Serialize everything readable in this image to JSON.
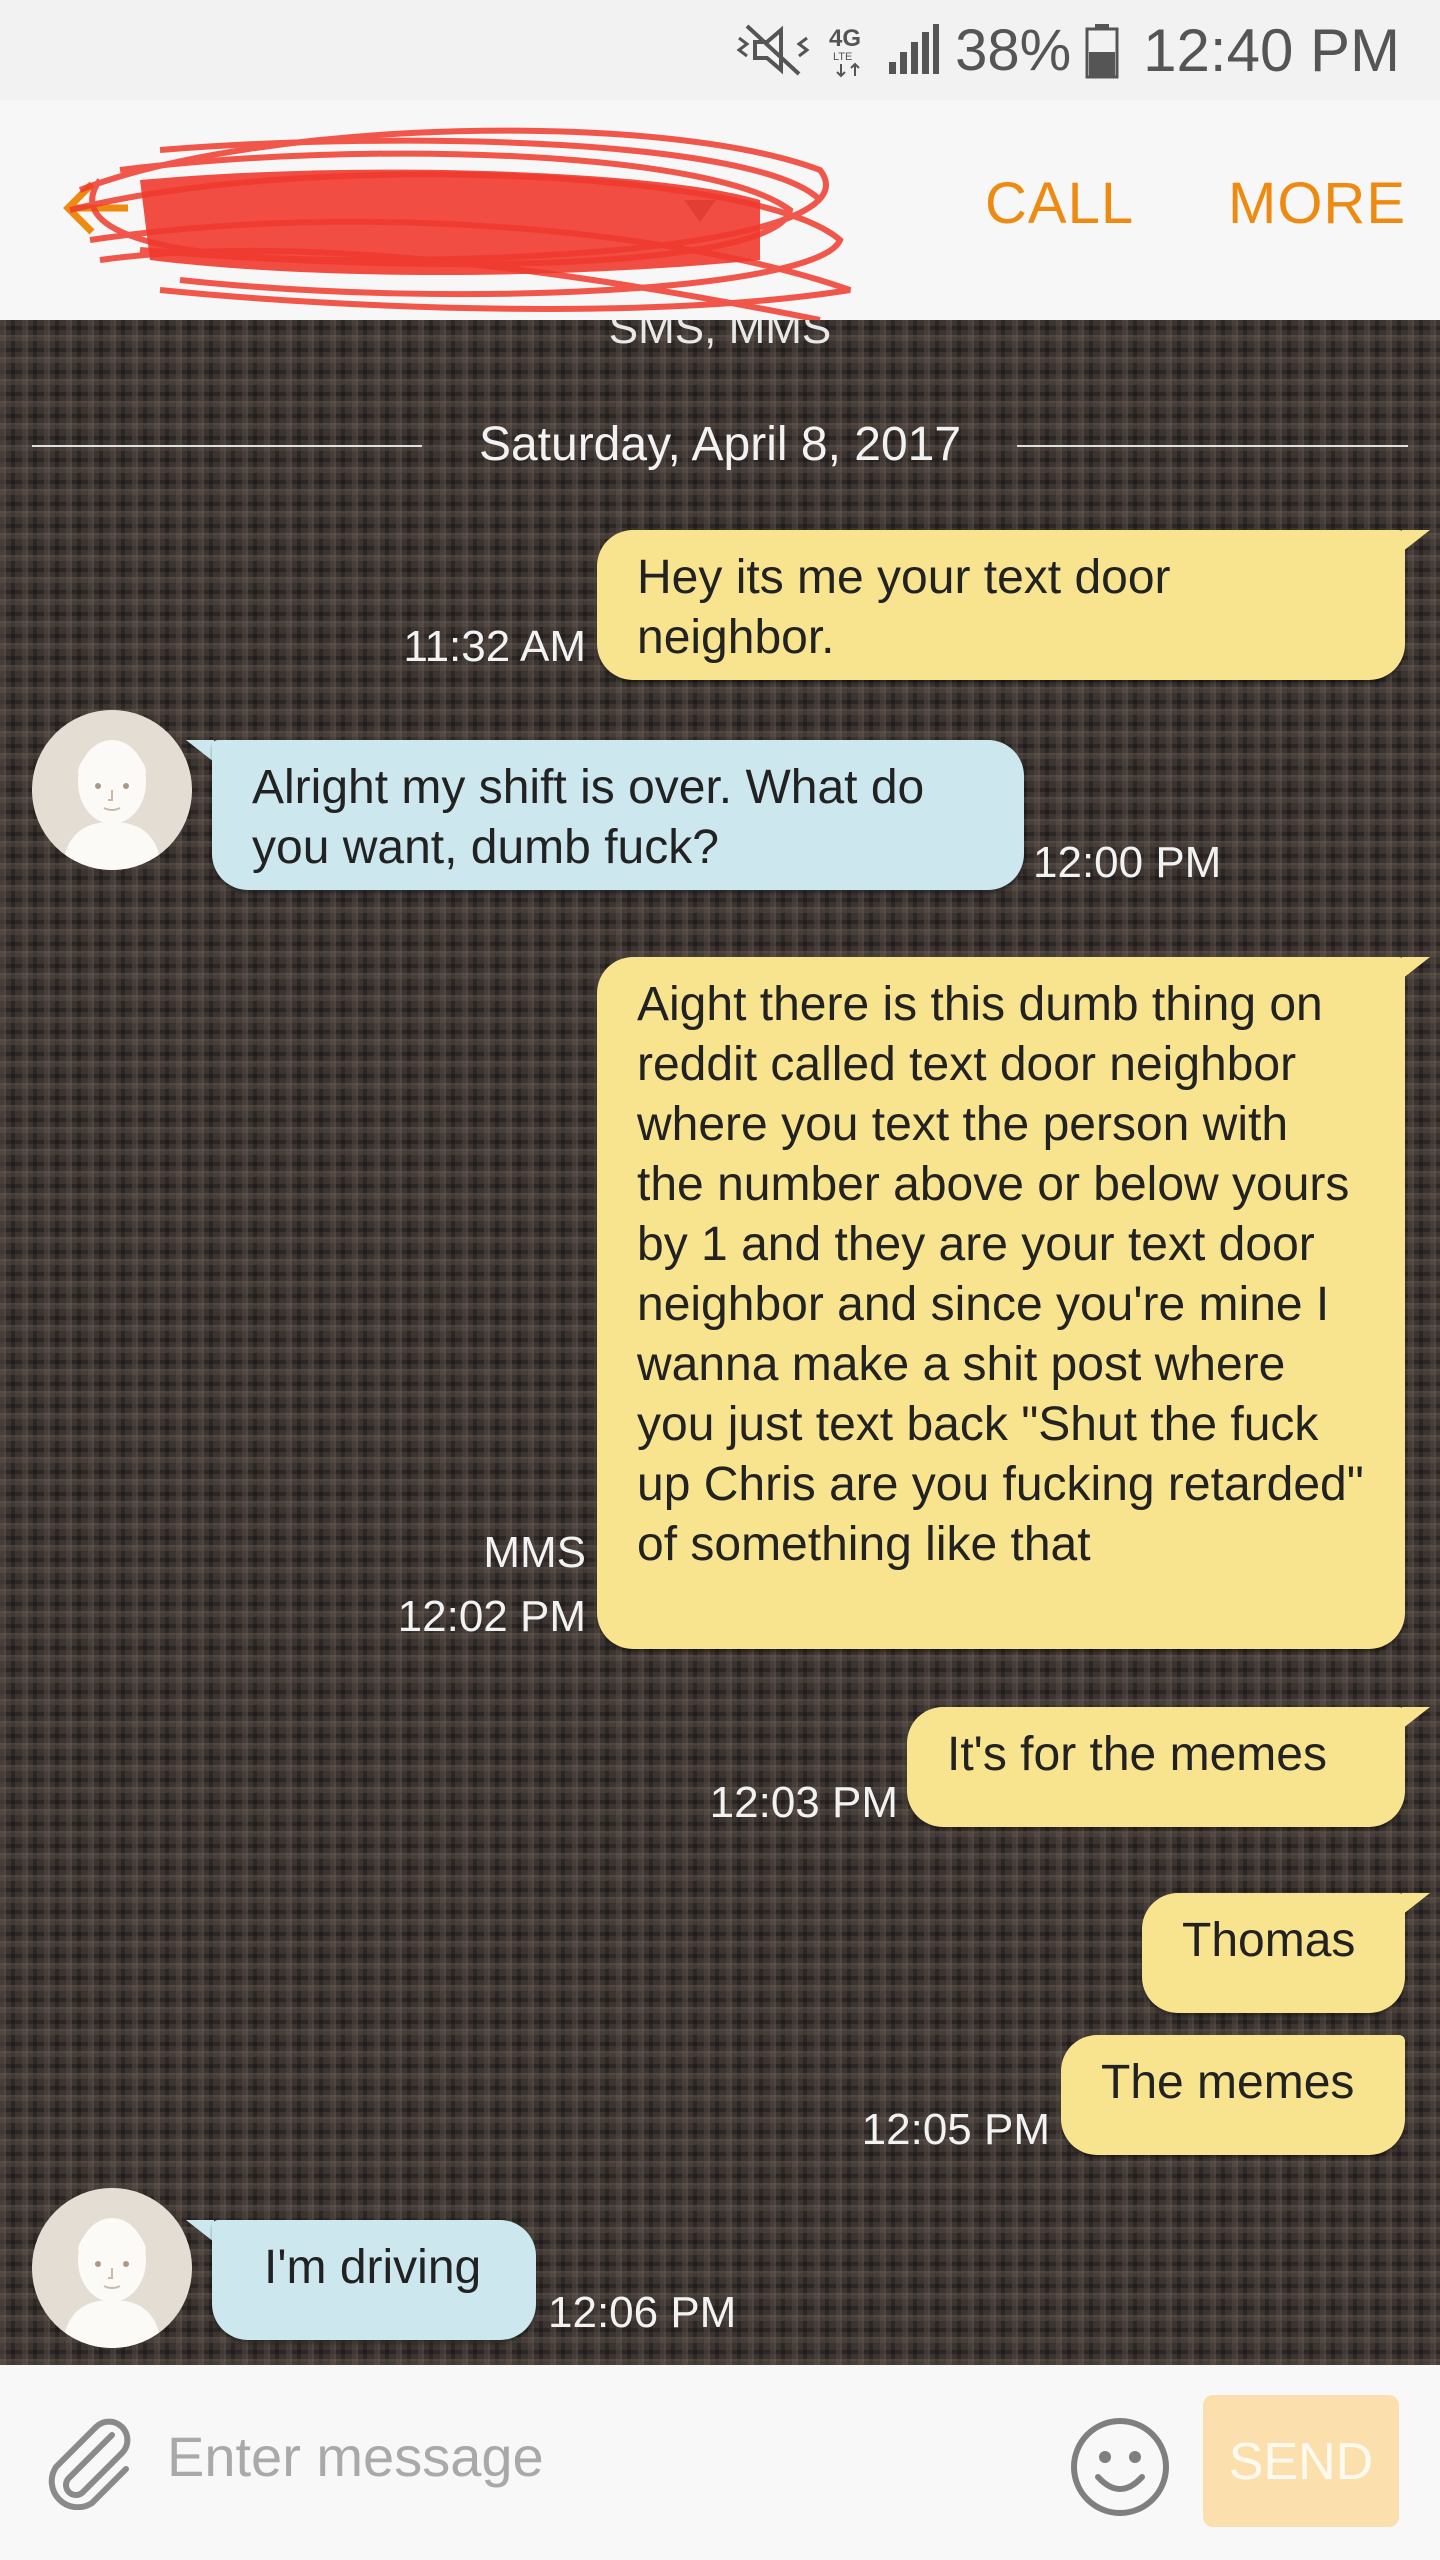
{
  "status_bar": {
    "battery": "38%",
    "time": "12:40 PM",
    "network": "4G"
  },
  "header": {
    "contact_name": "",
    "call_label": "CALL",
    "more_label": "MORE",
    "subtitle": "SMS, MMS"
  },
  "chat": {
    "date_separator": "Saturday, April 8, 2017",
    "messages": [
      {
        "direction": "out",
        "text": "Hey its me your text door neighbor.",
        "time": "11:32 AM"
      },
      {
        "direction": "in",
        "text": "Alright my shift is over. What do you want, dumb fuck?",
        "time": "12:00 PM"
      },
      {
        "direction": "out",
        "text": "Aight there is this dumb thing on reddit called text door neighbor where you text the person with the number above or below yours by 1 and they are your text door neighbor and since you're mine I wanna make a shit post where you just text back \"Shut the fuck up Chris are you fucking retarded\" of something like that",
        "time": "12:02 PM",
        "type_label": "MMS"
      },
      {
        "direction": "out",
        "text": "It's for the memes",
        "time": "12:03 PM"
      },
      {
        "direction": "out",
        "text": "Thomas",
        "time": ""
      },
      {
        "direction": "out",
        "text": "The memes",
        "time": "12:05 PM"
      },
      {
        "direction": "in",
        "text": "I'm driving",
        "time": "12:06 PM"
      }
    ]
  },
  "composer": {
    "placeholder": "Enter message",
    "send_label": "SEND"
  },
  "colors": {
    "accent": "#ee8a10",
    "outgoing_bubble": "#f8e48f",
    "incoming_bubble": "#cce8ee"
  }
}
